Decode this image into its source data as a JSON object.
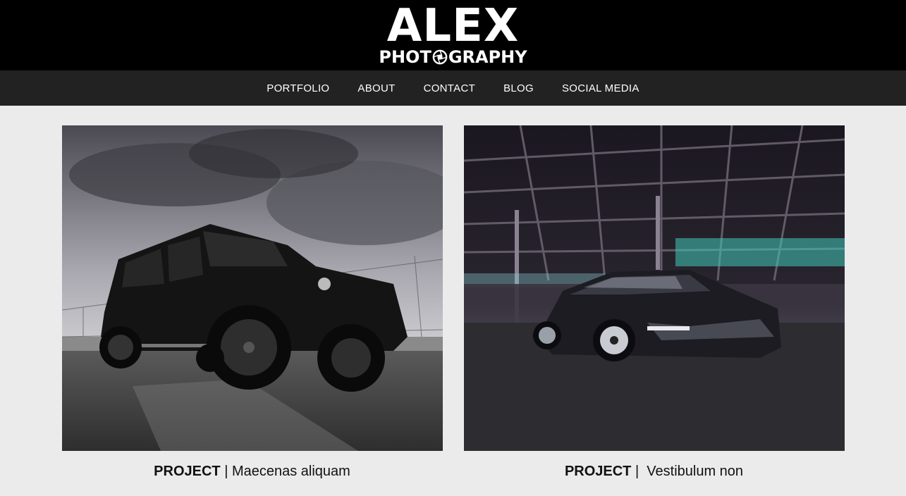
{
  "logo": {
    "main": "ALEX",
    "sub_left": "PHOT",
    "sub_right": "GRAPHY"
  },
  "nav": {
    "items": [
      "PORTFOLIO",
      "ABOUT",
      "CONTACT",
      "BLOG",
      "SOCIAL MEDIA"
    ]
  },
  "projects": [
    {
      "label": "PROJECT",
      "separator": " | ",
      "title": "Maecenas aliquam"
    },
    {
      "label": "PROJECT",
      "separator": " |  ",
      "title": "Vestibulum non"
    }
  ]
}
